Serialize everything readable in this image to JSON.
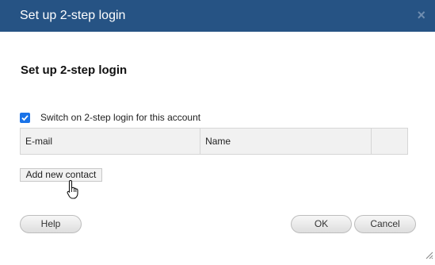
{
  "dialog": {
    "title": "Set up 2-step login",
    "close_symbol": "×"
  },
  "content": {
    "heading": "Set up 2-step login",
    "switch_checkbox": {
      "label": "Switch on 2-step login for this account",
      "checked": true
    },
    "contacts_table": {
      "columns": [
        "E-mail",
        "Name",
        ""
      ],
      "rows": []
    },
    "add_contact_label": "Add new contact"
  },
  "footer": {
    "help_label": "Help",
    "ok_label": "OK",
    "cancel_label": "Cancel"
  },
  "colors": {
    "titlebar": "#265384",
    "checkbox": "#1a73e8"
  },
  "icons": {
    "close": "close-icon",
    "cursor": "hand-pointer-icon",
    "resize": "resize-grip-icon"
  }
}
